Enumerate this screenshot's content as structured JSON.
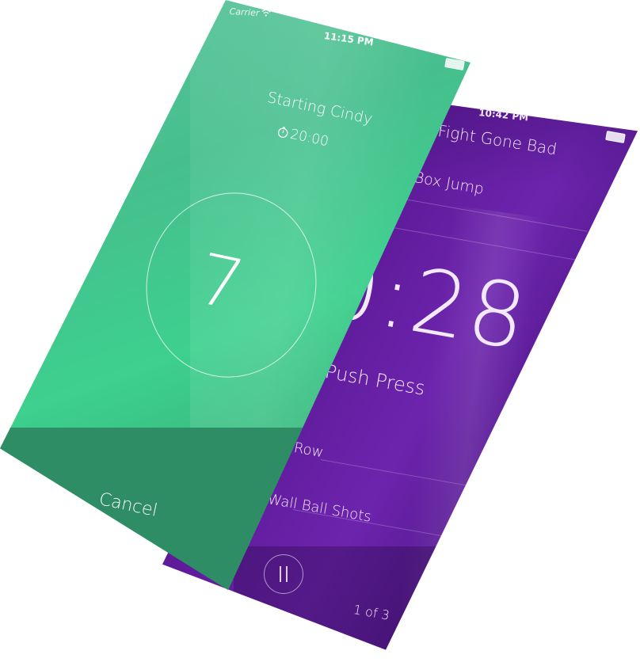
{
  "workout_screen": {
    "status_time": "10:42 PM",
    "title": "Fight Gone Bad",
    "exercises": [
      "Box Jump",
      "Push Press",
      "Row",
      "Wall Ball Shots"
    ],
    "timer": "0:28",
    "page": "1 of 3",
    "accent": "#6c24ad"
  },
  "countdown_screen": {
    "carrier": "Carrier",
    "status_time": "11:15 PM",
    "starting_label": "Starting Cindy",
    "timer": "20:00",
    "countdown": "7",
    "cancel_label": "Cancel",
    "accent": "#3dd08e"
  },
  "icons": {
    "wifi": "wifi-icon",
    "battery": "battery-icon",
    "stopwatch": "stopwatch-icon",
    "pause": "pause-icon"
  }
}
